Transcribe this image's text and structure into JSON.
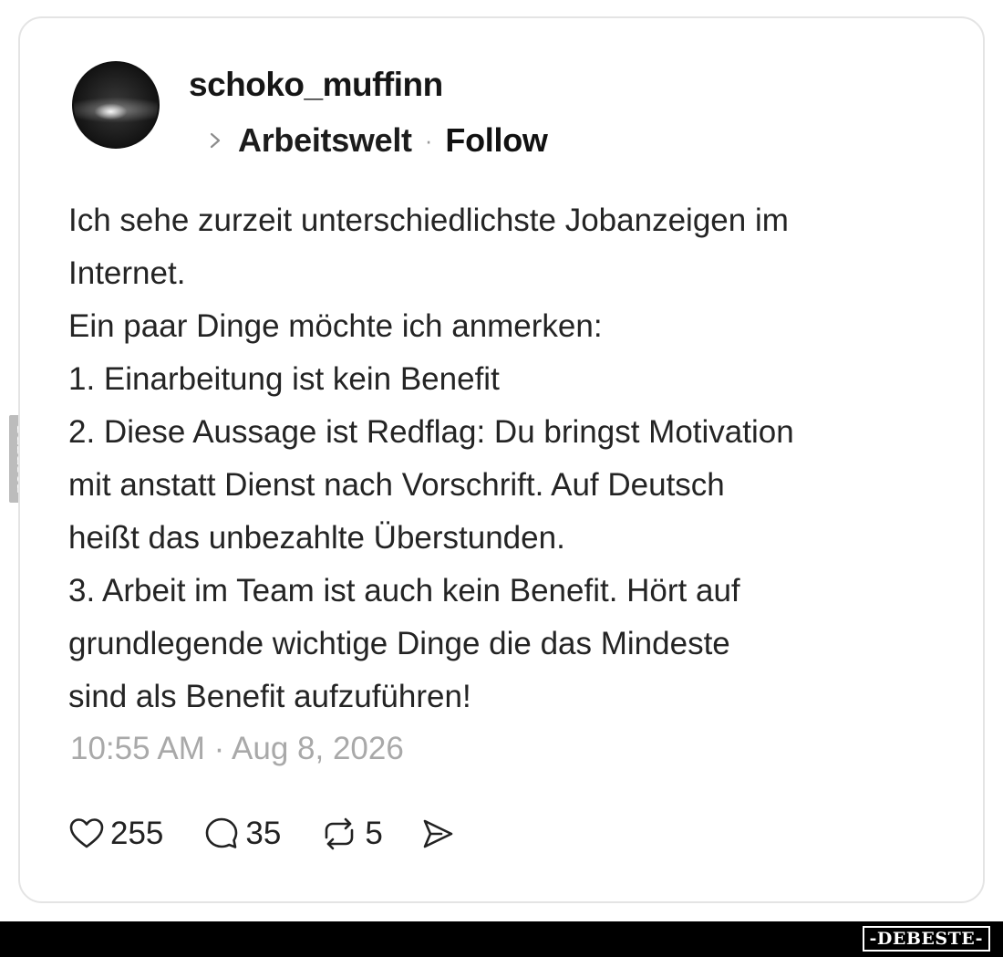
{
  "post": {
    "username": "schoko_muffinn",
    "topic": "Arbeitswelt",
    "separator": "·",
    "follow_label": "Follow",
    "body_lines": [
      "Ich sehe zurzeit unterschiedlichste Jobanzeigen im",
      "Internet.",
      "Ein paar Dinge möchte ich anmerken:",
      "1. Einarbeitung ist kein Benefit",
      "2. Diese Aussage ist Redflag: Du bringst Motivation",
      "mit anstatt Dienst nach Vorschrift. Auf Deutsch",
      "heißt das unbezahlte Überstunden.",
      "3. Arbeit im Team ist auch kein Benefit. Hört auf",
      "grundlegende wichtige Dinge die das Mindeste",
      "sind als Benefit aufzuführen!"
    ],
    "timestamp": "10:55 AM · Aug 8, 2026",
    "likes": "255",
    "replies": "35",
    "reposts": "5"
  },
  "icons": {
    "like": "heart-icon",
    "reply": "speech-bubble-icon",
    "repost": "repost-arrows-icon",
    "share": "send-arrow-icon",
    "topic": "chevron-right-icon"
  },
  "watermark": {
    "side": "DEBESTE",
    "footer": "-DEBESTE-"
  },
  "colors": {
    "text": "#242424",
    "muted": "#a9a9a9",
    "card_border": "#e4e4e4",
    "footer_bg": "#000000"
  }
}
